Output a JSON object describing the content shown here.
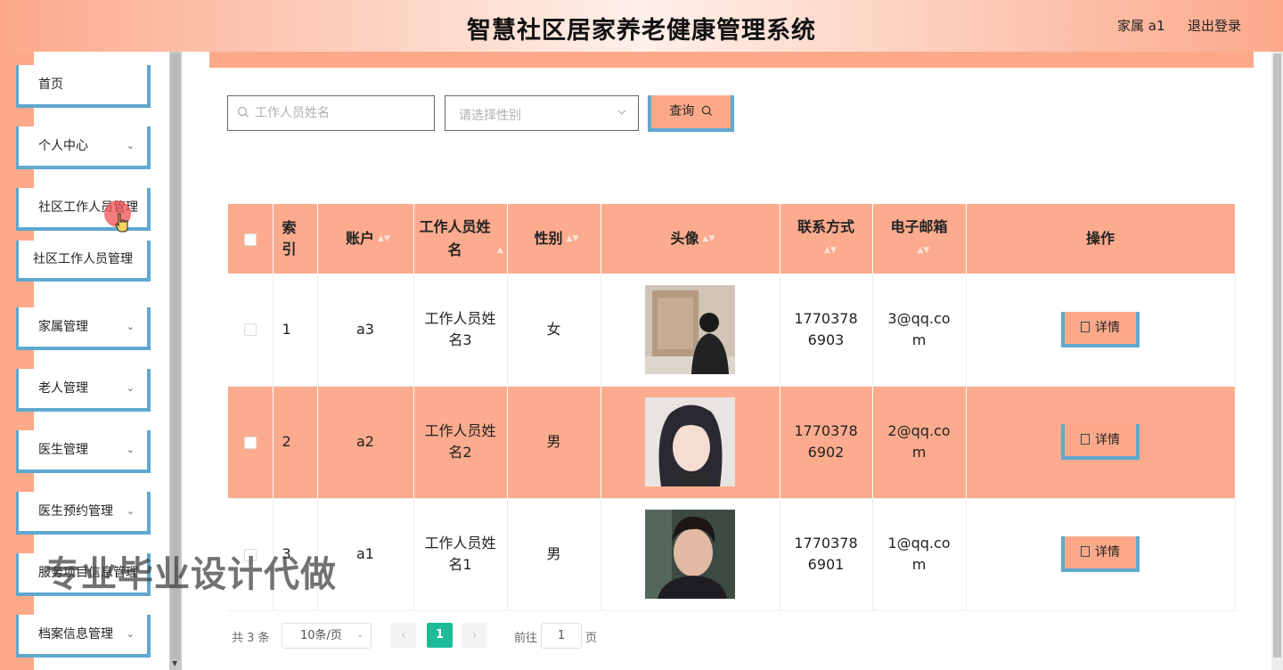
{
  "header": {
    "title": "智慧社区居家养老健康管理系统",
    "user": "家属 a1",
    "logout": "退出登录"
  },
  "sidebar": {
    "items": [
      {
        "label": "首页",
        "has_children": false
      },
      {
        "label": "个人中心",
        "has_children": true
      },
      {
        "label": "社区工作人员管理",
        "has_children": false,
        "expanded": true
      },
      {
        "label": "社区工作人员管理",
        "is_submenu": true
      },
      {
        "label": "家属管理",
        "has_children": true
      },
      {
        "label": "老人管理",
        "has_children": true
      },
      {
        "label": "医生管理",
        "has_children": true
      },
      {
        "label": "医生预约管理",
        "has_children": true
      },
      {
        "label": "服务项目信息管理",
        "has_children": true
      },
      {
        "label": "档案信息管理",
        "has_children": true
      }
    ]
  },
  "search": {
    "name_placeholder": "工作人员姓名",
    "gender_placeholder": "请选择性别",
    "query_label": "查询"
  },
  "table": {
    "headers": {
      "index": "索引",
      "account": "账户",
      "name": "工作人员姓名",
      "gender": "性别",
      "avatar": "头像",
      "phone": "联系方式",
      "email": "电子邮箱",
      "actions": "操作"
    },
    "rows": [
      {
        "index": "1",
        "account": "a3",
        "name": "工作人员姓名3",
        "gender": "女",
        "phone": "17703786903",
        "email": "3@qq.com",
        "detail": "详情"
      },
      {
        "index": "2",
        "account": "a2",
        "name": "工作人员姓名2",
        "gender": "男",
        "phone": "17703786902",
        "email": "2@qq.com",
        "detail": "详情"
      },
      {
        "index": "3",
        "account": "a1",
        "name": "工作人员姓名1",
        "gender": "男",
        "phone": "17703786901",
        "email": "1@qq.com",
        "detail": "详情"
      }
    ]
  },
  "pagination": {
    "total": "共 3 条",
    "page_size": "10条/页",
    "current_page": "1",
    "goto_prefix": "前往",
    "goto_value": "1",
    "goto_suffix": "页"
  },
  "watermark": "专业毕业设计代做",
  "colors": {
    "accent": "#fca98a",
    "border_accent": "#5fa8cf",
    "pager_active": "#1dbc98"
  }
}
